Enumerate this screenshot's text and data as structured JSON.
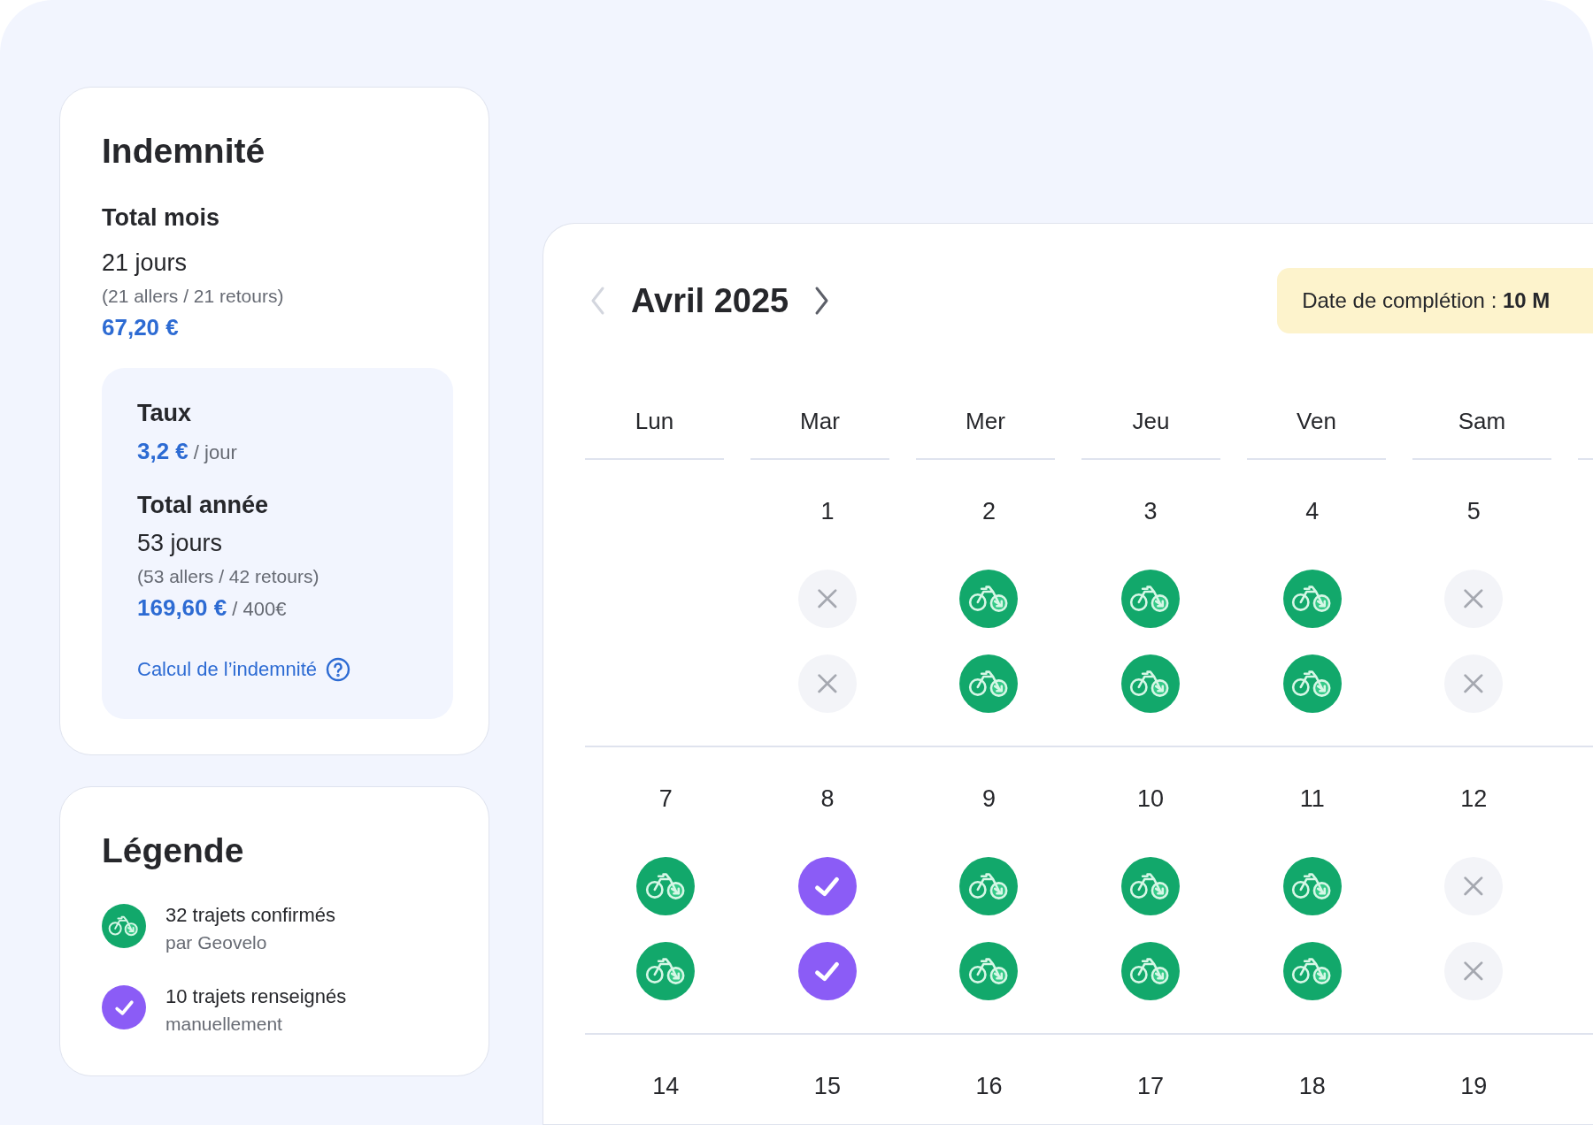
{
  "summary": {
    "title": "Indemnité",
    "month": {
      "heading": "Total mois",
      "days": "21 jours",
      "detail": "(21 allers / 21 retours)",
      "amount": "67,20 €"
    },
    "rate": {
      "heading": "Taux",
      "amount": "3,2 €",
      "unit": "/ jour"
    },
    "year": {
      "heading": "Total année",
      "days": "53 jours",
      "detail": "(53 allers / 42 retours)",
      "amount": "169,60 €",
      "cap": "/ 400€"
    },
    "help_link": "Calcul de l’indemnité"
  },
  "legend": {
    "title": "Légende",
    "items": [
      {
        "kind": "bike",
        "label": "32 trajets confirmés",
        "sub": "par Geovelo"
      },
      {
        "kind": "manual",
        "label": "10 trajets renseignés",
        "sub": "manuellement"
      }
    ]
  },
  "calendar": {
    "month_label": "Avril 2025",
    "prev": {
      "disabled": true
    },
    "next": {
      "disabled": false
    },
    "completion": "Date de complétion : **10 M**",
    "weekdays": [
      "Lun",
      "Mar",
      "Mer",
      "Jeu",
      "Ven",
      "Sam"
    ],
    "weeks": [
      {
        "days": [
          {
            "kind": "blank"
          },
          {
            "kind": "day",
            "date": "1",
            "trips": [
              {
                "kind": "none"
              },
              {
                "kind": "none"
              }
            ]
          },
          {
            "kind": "day",
            "date": "2",
            "trips": [
              {
                "kind": "bike"
              },
              {
                "kind": "bike"
              }
            ]
          },
          {
            "kind": "day",
            "date": "3",
            "trips": [
              {
                "kind": "bike"
              },
              {
                "kind": "bike"
              }
            ]
          },
          {
            "kind": "day",
            "date": "4",
            "trips": [
              {
                "kind": "bike"
              },
              {
                "kind": "bike"
              }
            ]
          },
          {
            "kind": "day",
            "date": "5",
            "trips": [
              {
                "kind": "none"
              },
              {
                "kind": "none"
              }
            ]
          }
        ]
      },
      {
        "days": [
          {
            "kind": "day",
            "date": "7",
            "trips": [
              {
                "kind": "bike"
              },
              {
                "kind": "bike"
              }
            ]
          },
          {
            "kind": "day",
            "date": "8",
            "trips": [
              {
                "kind": "manual"
              },
              {
                "kind": "manual"
              }
            ]
          },
          {
            "kind": "day",
            "date": "9",
            "trips": [
              {
                "kind": "bike"
              },
              {
                "kind": "bike"
              }
            ]
          },
          {
            "kind": "day",
            "date": "10",
            "trips": [
              {
                "kind": "bike"
              },
              {
                "kind": "bike"
              }
            ]
          },
          {
            "kind": "day",
            "date": "11",
            "trips": [
              {
                "kind": "bike"
              },
              {
                "kind": "bike"
              }
            ]
          },
          {
            "kind": "day",
            "date": "12",
            "trips": [
              {
                "kind": "none"
              },
              {
                "kind": "none"
              }
            ]
          }
        ]
      },
      {
        "days": [
          {
            "kind": "day",
            "date": "14"
          },
          {
            "kind": "day",
            "date": "15"
          },
          {
            "kind": "day",
            "date": "16"
          },
          {
            "kind": "day",
            "date": "17"
          },
          {
            "kind": "day",
            "date": "18"
          },
          {
            "kind": "day",
            "date": "19"
          }
        ]
      }
    ]
  }
}
